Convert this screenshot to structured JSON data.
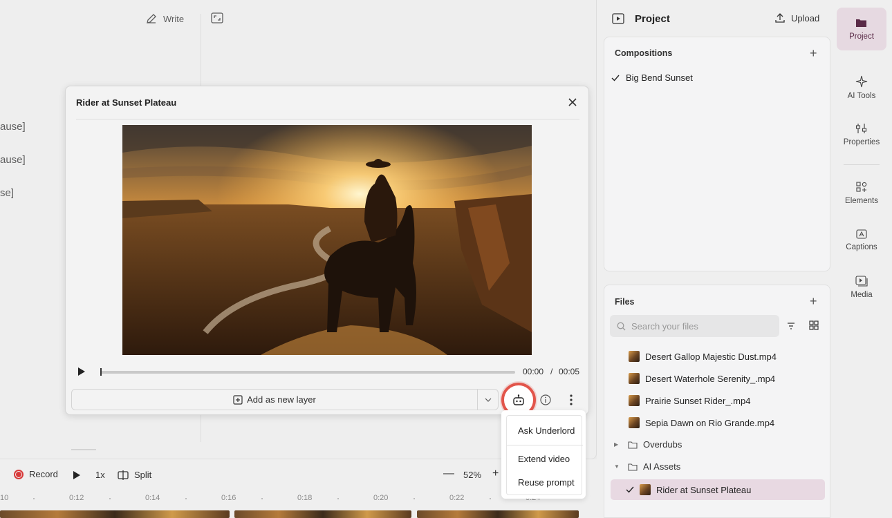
{
  "editor": {
    "write_label": "Write",
    "script_lines": [
      "ause]",
      "ause]",
      "se]"
    ]
  },
  "transport": {
    "record_label": "Record",
    "speed": "1x",
    "split_label": "Split",
    "zoom_out": "—",
    "zoom": "52%",
    "zoom_in": "+"
  },
  "ruler": {
    "ticks": [
      "10",
      "0:12",
      "0:14",
      "0:16",
      "0:18",
      "0:20",
      "0:22",
      "0:24"
    ]
  },
  "modal": {
    "title": "Rider at Sunset Plateau",
    "time_current": "00:00",
    "time_separator": "/",
    "time_total": "00:05",
    "playhead_fraction": 0,
    "add_layer_label": "Add as new layer"
  },
  "menu": {
    "items": [
      "Ask Underlord",
      "Extend video",
      "Reuse prompt"
    ]
  },
  "project": {
    "title": "Project",
    "upload_label": "Upload",
    "compositions_title": "Compositions",
    "compositions": [
      "Big Bend Sunset"
    ],
    "files_title": "Files",
    "search_placeholder": "Search your files",
    "files": [
      "Desert Gallop Majestic Dust.mp4",
      "Desert Waterhole Serenity_.mp4",
      "Prairie Sunset Rider_.mp4",
      "Sepia Dawn on Rio Grande.mp4"
    ],
    "folders": [
      "Overdubs",
      "AI Assets"
    ],
    "selected_file": "Rider at Sunset Plateau"
  },
  "rail": {
    "items": [
      "Project",
      "AI Tools",
      "Properties",
      "Elements",
      "Captions",
      "Media"
    ]
  },
  "colors": {
    "accent": "#e2554b",
    "selected_bg": "#e8d9e2",
    "rail_active": "#e6d9e1"
  }
}
